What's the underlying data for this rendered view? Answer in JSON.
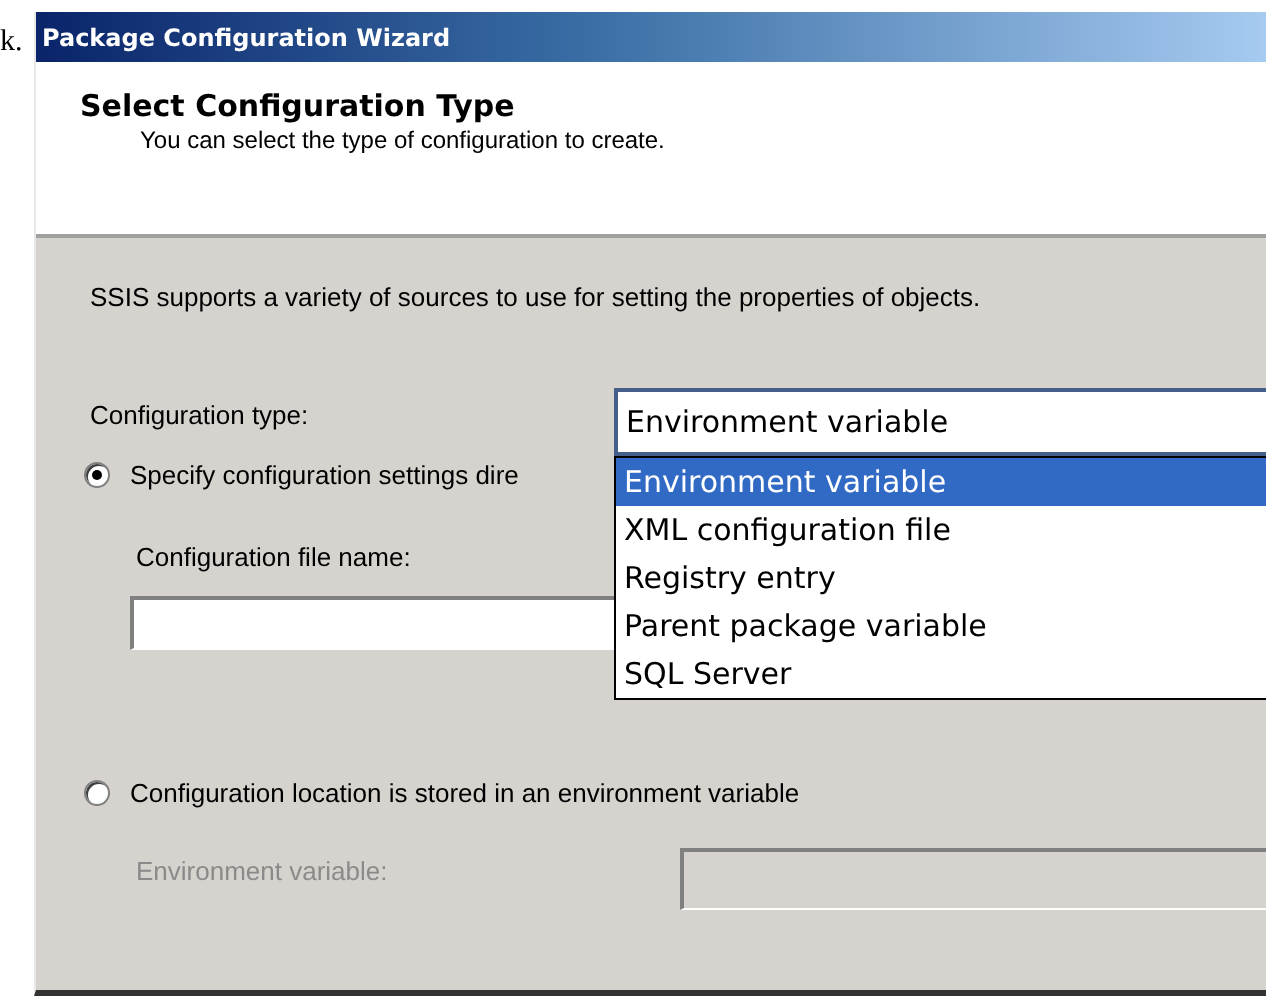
{
  "stray_text": "k.",
  "window": {
    "title": "Package Configuration Wizard"
  },
  "header": {
    "title": "Select Configuration Type",
    "subtitle": "You can select the type of configuration to create."
  },
  "intro": "SSIS supports a variety of sources to use for setting the properties of objects.",
  "configuration_type": {
    "label": "Configuration type:",
    "value": "Environment variable",
    "expanded": true,
    "options": [
      {
        "label": "Environment variable",
        "selected": true
      },
      {
        "label": "XML configuration file",
        "selected": false
      },
      {
        "label": "Registry entry",
        "selected": false
      },
      {
        "label": "Parent package variable",
        "selected": false
      },
      {
        "label": "SQL Server",
        "selected": false
      }
    ]
  },
  "choices": [
    {
      "kind": "stacked",
      "label": "Specify configuration settings dire",
      "selected": true,
      "field": {
        "label": "Configuration file name:",
        "disabled": false
      }
    },
    {
      "kind": "inline",
      "label": "Configuration location is stored in an environment variable",
      "selected": false,
      "field": {
        "label": "Environment variable:",
        "disabled": true
      }
    }
  ]
}
